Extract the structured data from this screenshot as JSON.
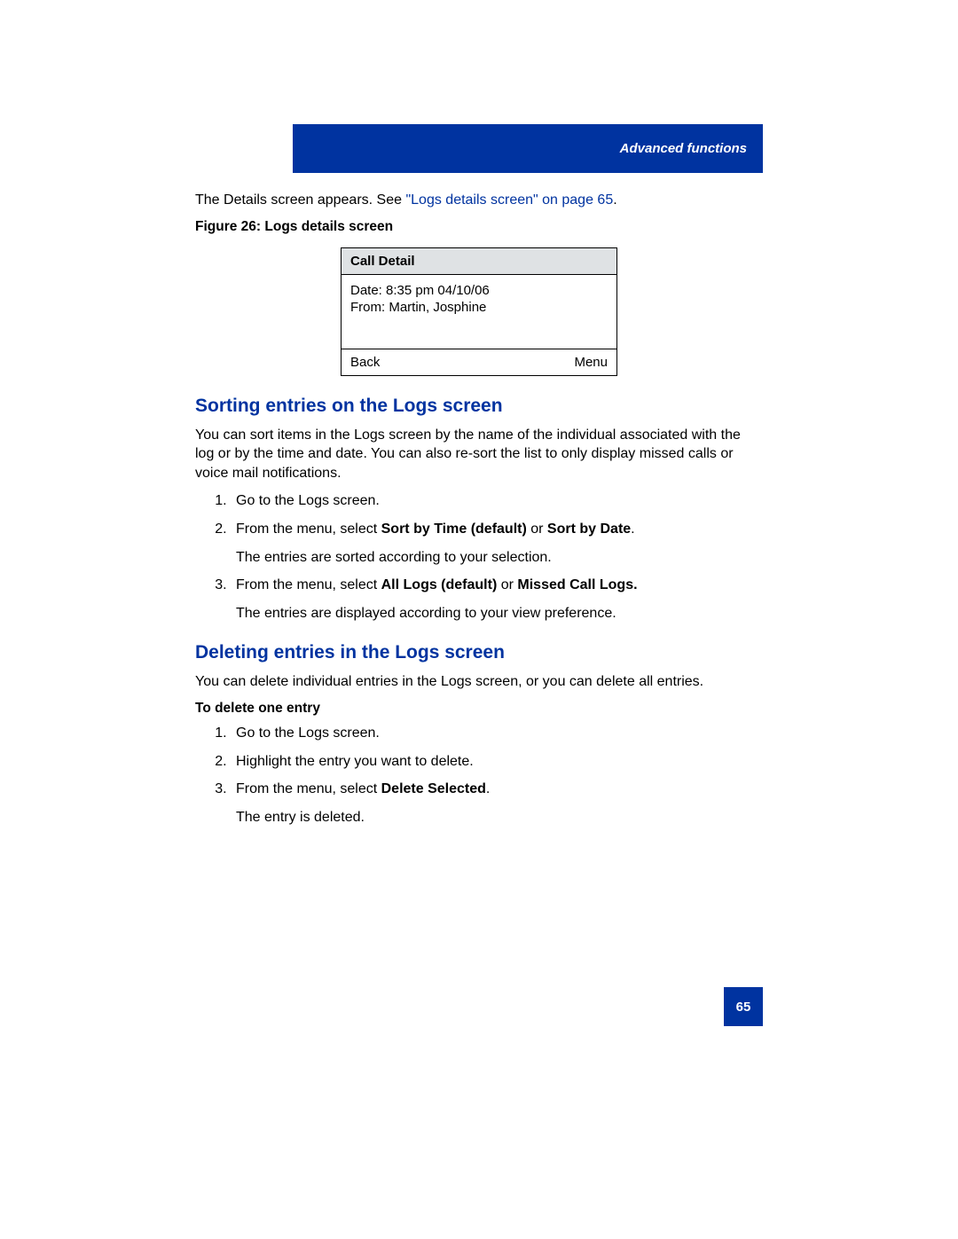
{
  "header": {
    "title": "Advanced functions"
  },
  "intro": {
    "pre": "The Details screen appears. See ",
    "link": "\"Logs details screen\" on page 65",
    "post": "."
  },
  "figure": {
    "caption": "Figure 26: Logs details screen",
    "title": "Call Detail",
    "line1": "Date: 8:35 pm 04/10/06",
    "line2": "From: Martin, Josphine",
    "back": "Back",
    "menu": "Menu"
  },
  "section1": {
    "heading": "Sorting entries on the Logs screen",
    "intro": "You can sort items in the Logs screen by the name of the individual associated with the log or by the time and date. You can also re-sort the list to only display missed calls or voice mail notifications.",
    "step1": "Go to the Logs screen.",
    "step2_pre": "From the menu, select ",
    "step2_b1": "Sort by Time (default)",
    "step2_or": " or ",
    "step2_b2": "Sort by Date",
    "step2_post": ".",
    "step2_after": "The entries are sorted according to your selection.",
    "step3_pre": "From the menu, select ",
    "step3_b1": "All Logs (default)",
    "step3_or": " or ",
    "step3_b2": "Missed Call Logs.",
    "step3_after": "The entries are displayed according to your view preference."
  },
  "section2": {
    "heading": "Deleting entries in the Logs screen",
    "intro": "You can delete individual entries in the Logs screen, or you can delete all entries.",
    "sub": "To delete one entry",
    "step1": "Go to the Logs screen.",
    "step2": "Highlight the entry you want to delete.",
    "step3_pre": "From the menu, select ",
    "step3_b": "Delete Selected",
    "step3_post": ".",
    "step3_after": "The entry is deleted."
  },
  "page_number": "65"
}
